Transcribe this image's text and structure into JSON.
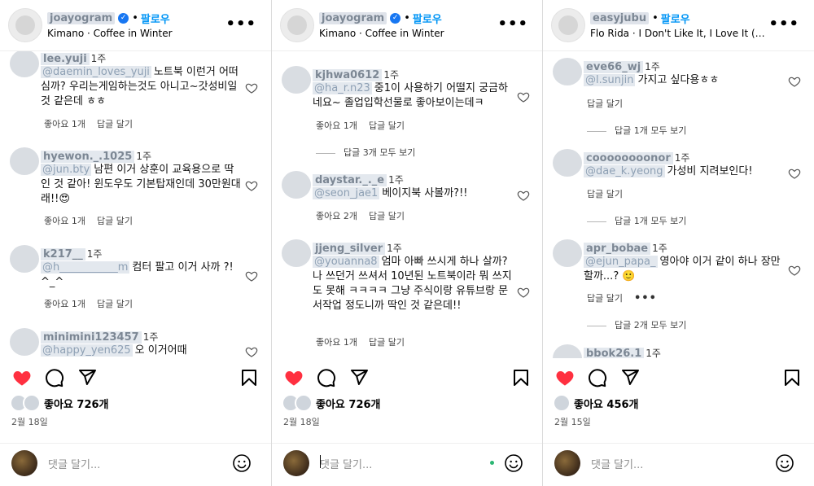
{
  "panels": [
    {
      "header": {
        "username": "joayogram",
        "verified": true,
        "follow_label": "팔로우",
        "subtitle": "Kimano · Coffee in Winter"
      },
      "comments": [
        {
          "user": "lee.yuji",
          "time": "1주",
          "mention": "@daemin_loves_yuji",
          "text": "노트북 이런거 어떠심까? 우리는게임하는것도 아니고~갓성비일것 같은데 ㅎㅎ",
          "likes_label": "좋아요 1개",
          "reply_label": "답글 달기"
        },
        {
          "user": "hyewon._.1025",
          "time": "1주",
          "mention": "@jun.bty",
          "text": "남편 이거 상훈이 교육용으로 딱인 것 같아! 윈도우도 기본탑재인데 30만원대래!!😍",
          "likes_label": "좋아요 1개",
          "reply_label": "답글 달기"
        },
        {
          "user": "k217__",
          "time": "1주",
          "mention": "@h___________m",
          "text": "컴터 팔고 이거 사까 ?! ^_^",
          "likes_label": "좋아요 1개",
          "reply_label": "답글 달기"
        },
        {
          "user": "minimini123457",
          "time": "1주",
          "mention": "@happy_yen625",
          "text": "오 이거어때"
        }
      ],
      "likes_text": "좋아요 726개",
      "date": "2월 18일",
      "add_comment_placeholder": "댓글 달기..."
    },
    {
      "header": {
        "username": "joayogram",
        "verified": true,
        "follow_label": "팔로우",
        "subtitle": "Kimano · Coffee in Winter"
      },
      "comments": [
        {
          "user": "kjhwa0612",
          "time": "1주",
          "mention": "@ha_r.n23",
          "text": "중1이 사용하기 어떨지 궁금하네요~ 졸업입학선물로 좋아보이는데ㅋ",
          "likes_label": "좋아요 1개",
          "reply_label": "답글 달기",
          "replies_label": "답글 3개 모두 보기"
        },
        {
          "user": "daystar._._e",
          "time": "1주",
          "mention": "@seon_jae1",
          "text": "베이지북 사볼까?!!",
          "likes_label": "좋아요 2개",
          "reply_label": "답글 달기"
        },
        {
          "user": "jjeng_silver",
          "time": "1주",
          "mention": "@youanna8",
          "text": "엄마 아빠 쓰시게 하나 살까? 나 쓰던거 쓰셔서 10년된 노트북이라 뭐 쓰지도 못해 ㅋㅋㅋㅋ 그냥 주식이랑 유튜브랑 문서작업 정도니까 딱인 것 같은데!!",
          "likes_label": "좋아요 1개",
          "reply_label": "답글 달기"
        }
      ],
      "likes_text": "좋아요 726개",
      "date": "2월 18일",
      "add_comment_placeholder": "댓글 달기..."
    },
    {
      "header": {
        "username": "easyjubu",
        "verified": false,
        "follow_label": "팔로우",
        "subtitle": "Flo Rida · I Don't Like It, I Love It (feat..."
      },
      "comments": [
        {
          "user": "eve66_wj",
          "time": "1주",
          "mention": "@l.sunjin",
          "text": "가지고 싶다용ㅎㅎ",
          "reply_label": "답글 달기",
          "replies_label": "답글 1개 모두 보기"
        },
        {
          "user": "coooooooonor",
          "time": "1주",
          "mention": "@dae_k.yeong",
          "text": "가성비 지려보인다!",
          "reply_label": "답글 달기",
          "replies_label": "답글 1개 모두 보기"
        },
        {
          "user": "apr_bobae",
          "time": "1주",
          "mention": "@ejun_papa_",
          "text": "영아야 이거 같이 하나 장만할까...? 🙂",
          "reply_label": "답글 달기",
          "more_label": "•••",
          "replies_label": "답글 2개 모두 보기"
        },
        {
          "user": "bbok26.1",
          "time": "1주"
        }
      ],
      "likes_text": "좋아요 456개",
      "date": "2월 15일",
      "add_comment_placeholder": "댓글 달기..."
    }
  ],
  "icons": [
    "heart-filled-icon",
    "comment-icon",
    "share-icon",
    "bookmark-icon",
    "heart-outline-icon",
    "emoji-icon",
    "more-icon"
  ],
  "colors": {
    "like_red": "#ff3040",
    "link_blue": "#0095f6",
    "verified_blue": "#1877f2",
    "mask_gray": "#e3e8ee"
  }
}
